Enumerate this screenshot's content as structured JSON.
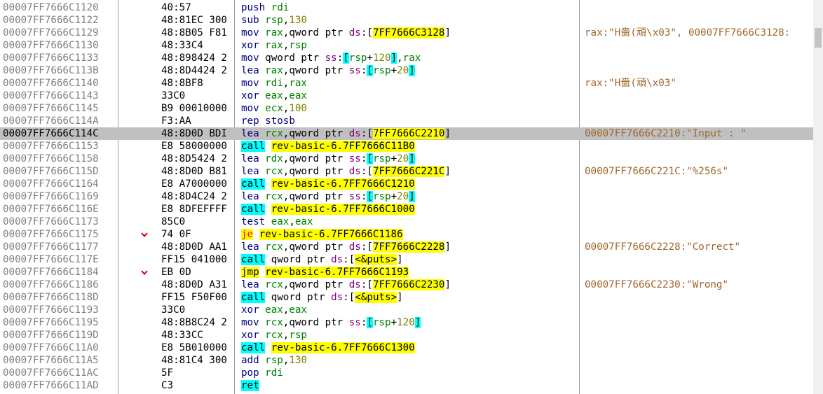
{
  "disassembly": {
    "rows": [
      {
        "address": "00007FF7666C1120",
        "bytes": "40:57",
        "jump": "",
        "selected": false,
        "tokens": [
          {
            "t": "push",
            "c": "mnem"
          },
          {
            "t": " ",
            "c": "plain"
          },
          {
            "t": "rdi",
            "c": "reg"
          }
        ],
        "comment": ""
      },
      {
        "address": "00007FF7666C1122",
        "bytes": "48:81EC 300",
        "jump": "",
        "selected": false,
        "tokens": [
          {
            "t": "sub",
            "c": "mnem"
          },
          {
            "t": " ",
            "c": "plain"
          },
          {
            "t": "rsp",
            "c": "reg"
          },
          {
            "t": ",",
            "c": "plain"
          },
          {
            "t": "130",
            "c": "num"
          }
        ],
        "comment": ""
      },
      {
        "address": "00007FF7666C1129",
        "bytes": "48:8B05 F81",
        "jump": "",
        "selected": false,
        "tokens": [
          {
            "t": "mov",
            "c": "mnem"
          },
          {
            "t": " ",
            "c": "plain"
          },
          {
            "t": "rax",
            "c": "reg"
          },
          {
            "t": ",qword ptr ",
            "c": "plain"
          },
          {
            "t": "ds",
            "c": "seg"
          },
          {
            "t": ":[",
            "c": "plain"
          },
          {
            "t": "7FF7666C3128",
            "c": "addrh"
          },
          {
            "t": "]",
            "c": "plain"
          }
        ],
        "comment": "rax:\"H嗇(頑\\x03\", 00007FF7666C3128:"
      },
      {
        "address": "00007FF7666C1130",
        "bytes": "48:33C4",
        "jump": "",
        "selected": false,
        "tokens": [
          {
            "t": "xor",
            "c": "mnem"
          },
          {
            "t": " ",
            "c": "plain"
          },
          {
            "t": "rax",
            "c": "reg"
          },
          {
            "t": ",",
            "c": "plain"
          },
          {
            "t": "rsp",
            "c": "reg"
          }
        ],
        "comment": ""
      },
      {
        "address": "00007FF7666C1133",
        "bytes": "48:898424 2",
        "jump": "",
        "selected": false,
        "tokens": [
          {
            "t": "mov",
            "c": "mnem"
          },
          {
            "t": " qword ptr ",
            "c": "plain"
          },
          {
            "t": "ss",
            "c": "seg"
          },
          {
            "t": ":",
            "c": "plain"
          },
          {
            "t": "[",
            "c": "br"
          },
          {
            "t": "rsp",
            "c": "reg"
          },
          {
            "t": "+",
            "c": "plain"
          },
          {
            "t": "120",
            "c": "num"
          },
          {
            "t": "]",
            "c": "br"
          },
          {
            "t": ",",
            "c": "plain"
          },
          {
            "t": "rax",
            "c": "reg"
          }
        ],
        "comment": ""
      },
      {
        "address": "00007FF7666C113B",
        "bytes": "48:8D4424 2",
        "jump": "",
        "selected": false,
        "tokens": [
          {
            "t": "lea",
            "c": "mnem"
          },
          {
            "t": " ",
            "c": "plain"
          },
          {
            "t": "rax",
            "c": "reg"
          },
          {
            "t": ",qword ptr ",
            "c": "plain"
          },
          {
            "t": "ss",
            "c": "seg"
          },
          {
            "t": ":",
            "c": "plain"
          },
          {
            "t": "[",
            "c": "br"
          },
          {
            "t": "rsp",
            "c": "reg"
          },
          {
            "t": "+",
            "c": "plain"
          },
          {
            "t": "20",
            "c": "num"
          },
          {
            "t": "]",
            "c": "br"
          }
        ],
        "comment": ""
      },
      {
        "address": "00007FF7666C1140",
        "bytes": "48:8BF8",
        "jump": "",
        "selected": false,
        "tokens": [
          {
            "t": "mov",
            "c": "mnem"
          },
          {
            "t": " ",
            "c": "plain"
          },
          {
            "t": "rdi",
            "c": "reg"
          },
          {
            "t": ",",
            "c": "plain"
          },
          {
            "t": "rax",
            "c": "reg"
          }
        ],
        "comment": "rax:\"H嗇(頑\\x03\""
      },
      {
        "address": "00007FF7666C1143",
        "bytes": "33C0",
        "jump": "",
        "selected": false,
        "tokens": [
          {
            "t": "xor",
            "c": "mnem"
          },
          {
            "t": " ",
            "c": "plain"
          },
          {
            "t": "eax",
            "c": "reg"
          },
          {
            "t": ",",
            "c": "plain"
          },
          {
            "t": "eax",
            "c": "reg"
          }
        ],
        "comment": ""
      },
      {
        "address": "00007FF7666C1145",
        "bytes": "B9 00010000",
        "jump": "",
        "selected": false,
        "tokens": [
          {
            "t": "mov",
            "c": "mnem"
          },
          {
            "t": " ",
            "c": "plain"
          },
          {
            "t": "ecx",
            "c": "reg"
          },
          {
            "t": ",",
            "c": "plain"
          },
          {
            "t": "100",
            "c": "num"
          }
        ],
        "comment": ""
      },
      {
        "address": "00007FF7666C114A",
        "bytes": "F3:AA",
        "jump": "",
        "selected": false,
        "tokens": [
          {
            "t": "rep stosb",
            "c": "mnem"
          }
        ],
        "comment": ""
      },
      {
        "address": "00007FF7666C114C",
        "bytes": "48:8D0D BDI",
        "jump": "",
        "selected": true,
        "tokens": [
          {
            "t": "lea",
            "c": "mnem"
          },
          {
            "t": " ",
            "c": "plain"
          },
          {
            "t": "rcx",
            "c": "reg"
          },
          {
            "t": ",qword ptr ",
            "c": "plain"
          },
          {
            "t": "ds",
            "c": "seg"
          },
          {
            "t": ":[",
            "c": "plain"
          },
          {
            "t": "7FF7666C2210",
            "c": "addrh"
          },
          {
            "t": "]",
            "c": "plain"
          }
        ],
        "comment": "00007FF7666C2210:\"Input : \""
      },
      {
        "address": "00007FF7666C1153",
        "bytes": "E8 58000000",
        "jump": "",
        "selected": false,
        "tokens": [
          {
            "t": "call",
            "c": "call"
          },
          {
            "t": " ",
            "c": "plain"
          },
          {
            "t": "rev-basic-6.7FF7666C11B0",
            "c": "lbl"
          }
        ],
        "comment": ""
      },
      {
        "address": "00007FF7666C1158",
        "bytes": "48:8D5424 2",
        "jump": "",
        "selected": false,
        "tokens": [
          {
            "t": "lea",
            "c": "mnem"
          },
          {
            "t": " ",
            "c": "plain"
          },
          {
            "t": "rdx",
            "c": "reg"
          },
          {
            "t": ",qword ptr ",
            "c": "plain"
          },
          {
            "t": "ss",
            "c": "seg"
          },
          {
            "t": ":",
            "c": "plain"
          },
          {
            "t": "[",
            "c": "br"
          },
          {
            "t": "rsp",
            "c": "reg"
          },
          {
            "t": "+",
            "c": "plain"
          },
          {
            "t": "20",
            "c": "num"
          },
          {
            "t": "]",
            "c": "br"
          }
        ],
        "comment": ""
      },
      {
        "address": "00007FF7666C115D",
        "bytes": "48:8D0D B81",
        "jump": "",
        "selected": false,
        "tokens": [
          {
            "t": "lea",
            "c": "mnem"
          },
          {
            "t": " ",
            "c": "plain"
          },
          {
            "t": "rcx",
            "c": "reg"
          },
          {
            "t": ",qword ptr ",
            "c": "plain"
          },
          {
            "t": "ds",
            "c": "seg"
          },
          {
            "t": ":[",
            "c": "plain"
          },
          {
            "t": "7FF7666C221C",
            "c": "addrh"
          },
          {
            "t": "]",
            "c": "plain"
          }
        ],
        "comment": "00007FF7666C221C:\"%256s\""
      },
      {
        "address": "00007FF7666C1164",
        "bytes": "E8 A7000000",
        "jump": "",
        "selected": false,
        "tokens": [
          {
            "t": "call",
            "c": "call"
          },
          {
            "t": " ",
            "c": "plain"
          },
          {
            "t": "rev-basic-6.7FF7666C1210",
            "c": "lbl"
          }
        ],
        "comment": ""
      },
      {
        "address": "00007FF7666C1169",
        "bytes": "48:8D4C24 2",
        "jump": "",
        "selected": false,
        "tokens": [
          {
            "t": "lea",
            "c": "mnem"
          },
          {
            "t": " ",
            "c": "plain"
          },
          {
            "t": "rcx",
            "c": "reg"
          },
          {
            "t": ",qword ptr ",
            "c": "plain"
          },
          {
            "t": "ss",
            "c": "seg"
          },
          {
            "t": ":",
            "c": "plain"
          },
          {
            "t": "[",
            "c": "br"
          },
          {
            "t": "rsp",
            "c": "reg"
          },
          {
            "t": "+",
            "c": "plain"
          },
          {
            "t": "20",
            "c": "num"
          },
          {
            "t": "]",
            "c": "br"
          }
        ],
        "comment": ""
      },
      {
        "address": "00007FF7666C116E",
        "bytes": "E8 8DFEFFFF",
        "jump": "",
        "selected": false,
        "tokens": [
          {
            "t": "call",
            "c": "call"
          },
          {
            "t": " ",
            "c": "plain"
          },
          {
            "t": "rev-basic-6.7FF7666C1000",
            "c": "lbl"
          }
        ],
        "comment": ""
      },
      {
        "address": "00007FF7666C1173",
        "bytes": "85C0",
        "jump": "",
        "selected": false,
        "tokens": [
          {
            "t": "test",
            "c": "mnem"
          },
          {
            "t": " ",
            "c": "plain"
          },
          {
            "t": "eax",
            "c": "reg"
          },
          {
            "t": ",",
            "c": "plain"
          },
          {
            "t": "eax",
            "c": "reg"
          }
        ],
        "comment": ""
      },
      {
        "address": "00007FF7666C1175",
        "bytes": "74 0F",
        "jump": "v",
        "selected": false,
        "tokens": [
          {
            "t": "je",
            "c": "jcc"
          },
          {
            "t": " ",
            "c": "plain"
          },
          {
            "t": "rev-basic-6.7FF7666C1186",
            "c": "lbl"
          }
        ],
        "comment": ""
      },
      {
        "address": "00007FF7666C1177",
        "bytes": "48:8D0D AA1",
        "jump": "",
        "selected": false,
        "tokens": [
          {
            "t": "lea",
            "c": "mnem"
          },
          {
            "t": " ",
            "c": "plain"
          },
          {
            "t": "rcx",
            "c": "reg"
          },
          {
            "t": ",qword ptr ",
            "c": "plain"
          },
          {
            "t": "ds",
            "c": "seg"
          },
          {
            "t": ":[",
            "c": "plain"
          },
          {
            "t": "7FF7666C2228",
            "c": "addrh"
          },
          {
            "t": "]",
            "c": "plain"
          }
        ],
        "comment": "00007FF7666C2228:\"Correct\""
      },
      {
        "address": "00007FF7666C117E",
        "bytes": "FF15 041000",
        "jump": "",
        "selected": false,
        "tokens": [
          {
            "t": "call",
            "c": "call"
          },
          {
            "t": " qword ptr ",
            "c": "plain"
          },
          {
            "t": "ds",
            "c": "seg"
          },
          {
            "t": ":[",
            "c": "plain"
          },
          {
            "t": "<&puts>",
            "c": "addrh"
          },
          {
            "t": "]",
            "c": "plain"
          }
        ],
        "comment": ""
      },
      {
        "address": "00007FF7666C1184",
        "bytes": "EB 0D",
        "jump": "v",
        "selected": false,
        "tokens": [
          {
            "t": "jmp",
            "c": "jmpm"
          },
          {
            "t": " ",
            "c": "plain"
          },
          {
            "t": "rev-basic-6.7FF7666C1193",
            "c": "lbl"
          }
        ],
        "comment": ""
      },
      {
        "address": "00007FF7666C1186",
        "bytes": "48:8D0D A31",
        "jump": "",
        "selected": false,
        "tokens": [
          {
            "t": "lea",
            "c": "mnem"
          },
          {
            "t": " ",
            "c": "plain"
          },
          {
            "t": "rcx",
            "c": "reg"
          },
          {
            "t": ",qword ptr ",
            "c": "plain"
          },
          {
            "t": "ds",
            "c": "seg"
          },
          {
            "t": ":[",
            "c": "plain"
          },
          {
            "t": "7FF7666C2230",
            "c": "addrh"
          },
          {
            "t": "]",
            "c": "plain"
          }
        ],
        "comment": "00007FF7666C2230:\"Wrong\""
      },
      {
        "address": "00007FF7666C118D",
        "bytes": "FF15 F50F00",
        "jump": "",
        "selected": false,
        "tokens": [
          {
            "t": "call",
            "c": "call"
          },
          {
            "t": " qword ptr ",
            "c": "plain"
          },
          {
            "t": "ds",
            "c": "seg"
          },
          {
            "t": ":[",
            "c": "plain"
          },
          {
            "t": "<&puts>",
            "c": "addrh"
          },
          {
            "t": "]",
            "c": "plain"
          }
        ],
        "comment": ""
      },
      {
        "address": "00007FF7666C1193",
        "bytes": "33C0",
        "jump": "",
        "selected": false,
        "tokens": [
          {
            "t": "xor",
            "c": "mnem"
          },
          {
            "t": " ",
            "c": "plain"
          },
          {
            "t": "eax",
            "c": "reg"
          },
          {
            "t": ",",
            "c": "plain"
          },
          {
            "t": "eax",
            "c": "reg"
          }
        ],
        "comment": ""
      },
      {
        "address": "00007FF7666C1195",
        "bytes": "48:8B8C24 2",
        "jump": "",
        "selected": false,
        "tokens": [
          {
            "t": "mov",
            "c": "mnem"
          },
          {
            "t": " ",
            "c": "plain"
          },
          {
            "t": "rcx",
            "c": "reg"
          },
          {
            "t": ",qword ptr ",
            "c": "plain"
          },
          {
            "t": "ss",
            "c": "seg"
          },
          {
            "t": ":",
            "c": "plain"
          },
          {
            "t": "[",
            "c": "br"
          },
          {
            "t": "rsp",
            "c": "reg"
          },
          {
            "t": "+",
            "c": "plain"
          },
          {
            "t": "120",
            "c": "num"
          },
          {
            "t": "]",
            "c": "br"
          }
        ],
        "comment": ""
      },
      {
        "address": "00007FF7666C119D",
        "bytes": "48:33CC",
        "jump": "",
        "selected": false,
        "tokens": [
          {
            "t": "xor",
            "c": "mnem"
          },
          {
            "t": " ",
            "c": "plain"
          },
          {
            "t": "rcx",
            "c": "reg"
          },
          {
            "t": ",",
            "c": "plain"
          },
          {
            "t": "rsp",
            "c": "reg"
          }
        ],
        "comment": ""
      },
      {
        "address": "00007FF7666C11A0",
        "bytes": "E8 5B010000",
        "jump": "",
        "selected": false,
        "tokens": [
          {
            "t": "call",
            "c": "call"
          },
          {
            "t": " ",
            "c": "plain"
          },
          {
            "t": "rev-basic-6.7FF7666C1300",
            "c": "lbl"
          }
        ],
        "comment": ""
      },
      {
        "address": "00007FF7666C11A5",
        "bytes": "48:81C4 300",
        "jump": "",
        "selected": false,
        "tokens": [
          {
            "t": "add",
            "c": "mnem"
          },
          {
            "t": " ",
            "c": "plain"
          },
          {
            "t": "rsp",
            "c": "reg"
          },
          {
            "t": ",",
            "c": "plain"
          },
          {
            "t": "130",
            "c": "num"
          }
        ],
        "comment": ""
      },
      {
        "address": "00007FF7666C11AC",
        "bytes": "5F",
        "jump": "",
        "selected": false,
        "tokens": [
          {
            "t": "pop",
            "c": "mnem"
          },
          {
            "t": " ",
            "c": "plain"
          },
          {
            "t": "rdi",
            "c": "reg"
          }
        ],
        "comment": ""
      },
      {
        "address": "00007FF7666C11AD",
        "bytes": "C3",
        "jump": "",
        "selected": false,
        "tokens": [
          {
            "t": "ret",
            "c": "ret"
          }
        ],
        "comment": ""
      }
    ]
  },
  "icons": {
    "jump_arrow": "chevron-down-icon"
  },
  "colors": {
    "selected_row": "#c0c0c0",
    "call_bg": "#00ffff",
    "label_bg": "#ffff00",
    "jump_red": "#e00000",
    "comment": "#a0662b"
  }
}
